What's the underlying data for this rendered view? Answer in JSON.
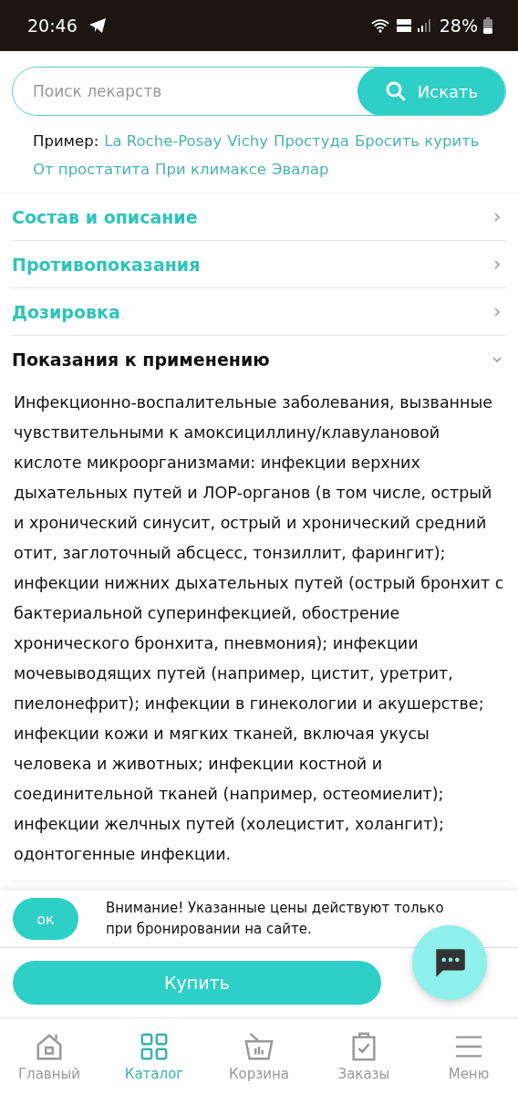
{
  "status_bar": {
    "time": "20:46",
    "battery": "28%"
  },
  "search": {
    "placeholder": "Поиск лекарств",
    "button": "Искать"
  },
  "examples": {
    "label": "Пример:",
    "links": [
      "La Roche-Posay",
      "Vichy",
      "Простуда",
      "Бросить курить",
      "От простатита",
      "При климаксе",
      "Эвалар"
    ]
  },
  "sections": [
    {
      "title": "Состав и описание",
      "expanded": false
    },
    {
      "title": "Противопоказания",
      "expanded": false
    },
    {
      "title": "Дозировка",
      "expanded": false
    },
    {
      "title": "Показания к применению",
      "expanded": true,
      "body": "Инфекционно-воспалительные заболевания, вызванные чувствительными к амоксициллину/клавулановой кислоте микроорганизмами: инфекции верхних дыхательных путей и ЛОР-органов (в том числе, острый и хронический синусит, острый и хронический средний отит, заглоточный абсцесс, тонзиллит, фарингит); инфекции нижних дыхательных путей (острый бронхит с бактериальной суперинфекцией, обострение хронического бронхита, пневмония); инфекции мочевыводящих путей (например, цистит, уретрит, пиелонефрит); инфекции в гинекологии и акушерстве; инфекции кожи и мягких тканей, включая укусы человека и животных; инфекции костной и соединительной тканей (например, остеомиелит); инфекции желчных путей (холецистит, холангит); одонтогенные инфекции."
    }
  ],
  "notice": {
    "ok": "ок",
    "text": "Внимание! Указанные цены действуют только при бронировании на сайте."
  },
  "buy_button": "Купить",
  "nav": [
    {
      "label": "Главный",
      "selected": false
    },
    {
      "label": "Каталог",
      "selected": true
    },
    {
      "label": "Корзина",
      "selected": false
    },
    {
      "label": "Заказы",
      "selected": false
    },
    {
      "label": "Меню",
      "selected": false
    }
  ]
}
